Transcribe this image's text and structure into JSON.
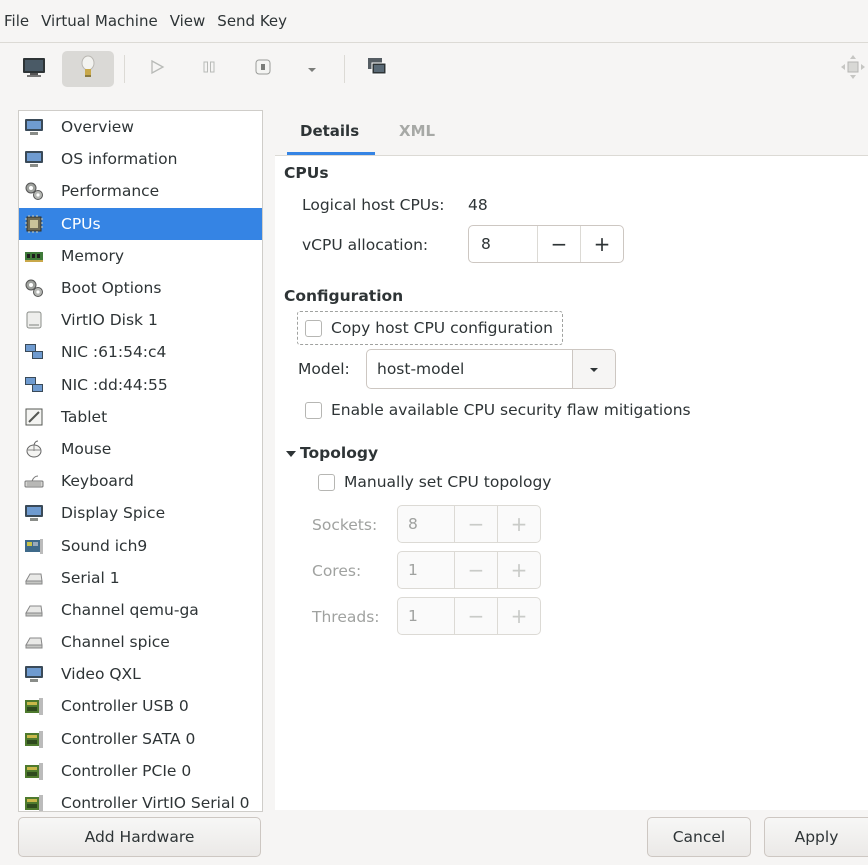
{
  "menu": [
    "File",
    "Virtual Machine",
    "View",
    "Send Key"
  ],
  "sidebar": {
    "items": [
      {
        "label": "Overview",
        "icon": "monitor-icon"
      },
      {
        "label": "OS information",
        "icon": "monitor-icon"
      },
      {
        "label": "Performance",
        "icon": "gears-icon"
      },
      {
        "label": "CPUs",
        "icon": "chip-icon"
      },
      {
        "label": "Memory",
        "icon": "memory-icon"
      },
      {
        "label": "Boot Options",
        "icon": "gears-icon"
      },
      {
        "label": "VirtIO Disk 1",
        "icon": "disk-icon"
      },
      {
        "label": "NIC :61:54:c4",
        "icon": "network-icon"
      },
      {
        "label": "NIC :dd:44:55",
        "icon": "network-icon"
      },
      {
        "label": "Tablet",
        "icon": "tablet-icon"
      },
      {
        "label": "Mouse",
        "icon": "mouse-icon"
      },
      {
        "label": "Keyboard",
        "icon": "keyboard-icon"
      },
      {
        "label": "Display Spice",
        "icon": "monitor-icon"
      },
      {
        "label": "Sound ich9",
        "icon": "sound-card-icon"
      },
      {
        "label": "Serial 1",
        "icon": "serial-icon"
      },
      {
        "label": "Channel qemu-ga",
        "icon": "serial-icon"
      },
      {
        "label": "Channel spice",
        "icon": "serial-icon"
      },
      {
        "label": "Video QXL",
        "icon": "monitor-icon"
      },
      {
        "label": "Controller USB 0",
        "icon": "controller-icon"
      },
      {
        "label": "Controller SATA 0",
        "icon": "controller-icon"
      },
      {
        "label": "Controller PCIe 0",
        "icon": "controller-icon"
      },
      {
        "label": "Controller VirtIO Serial 0",
        "icon": "controller-icon"
      }
    ],
    "selected_index": 3
  },
  "tabs": {
    "details": "Details",
    "xml": "XML"
  },
  "cpus": {
    "heading": "CPUs",
    "logical_label": "Logical host CPUs:",
    "logical_value": "48",
    "vcpu_label": "vCPU allocation:",
    "vcpu_value": "8"
  },
  "configuration": {
    "heading": "Configuration",
    "copy_host": "Copy host CPU configuration",
    "model_label": "Model:",
    "model_value": "host-model",
    "security": "Enable available CPU security flaw mitigations"
  },
  "topology": {
    "heading": "Topology",
    "manual": "Manually set CPU topology",
    "sockets_label": "Sockets:",
    "sockets_value": "8",
    "cores_label": "Cores:",
    "cores_value": "1",
    "threads_label": "Threads:",
    "threads_value": "1"
  },
  "buttons": {
    "add_hardware": "Add Hardware",
    "cancel": "Cancel",
    "apply": "Apply"
  },
  "spin_symbols": {
    "minus": "−",
    "plus": "+"
  },
  "colors": {
    "accent": "#3584e4"
  }
}
